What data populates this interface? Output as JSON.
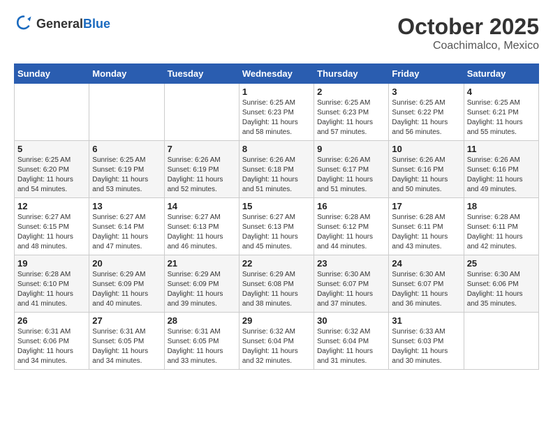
{
  "header": {
    "logo_line1": "General",
    "logo_line2": "Blue",
    "title": "October 2025",
    "subtitle": "Coachimalco, Mexico"
  },
  "days_of_week": [
    "Sunday",
    "Monday",
    "Tuesday",
    "Wednesday",
    "Thursday",
    "Friday",
    "Saturday"
  ],
  "weeks": [
    [
      {
        "day": "",
        "info": ""
      },
      {
        "day": "",
        "info": ""
      },
      {
        "day": "",
        "info": ""
      },
      {
        "day": "1",
        "info": "Sunrise: 6:25 AM\nSunset: 6:23 PM\nDaylight: 11 hours\nand 58 minutes."
      },
      {
        "day": "2",
        "info": "Sunrise: 6:25 AM\nSunset: 6:23 PM\nDaylight: 11 hours\nand 57 minutes."
      },
      {
        "day": "3",
        "info": "Sunrise: 6:25 AM\nSunset: 6:22 PM\nDaylight: 11 hours\nand 56 minutes."
      },
      {
        "day": "4",
        "info": "Sunrise: 6:25 AM\nSunset: 6:21 PM\nDaylight: 11 hours\nand 55 minutes."
      }
    ],
    [
      {
        "day": "5",
        "info": "Sunrise: 6:25 AM\nSunset: 6:20 PM\nDaylight: 11 hours\nand 54 minutes."
      },
      {
        "day": "6",
        "info": "Sunrise: 6:25 AM\nSunset: 6:19 PM\nDaylight: 11 hours\nand 53 minutes."
      },
      {
        "day": "7",
        "info": "Sunrise: 6:26 AM\nSunset: 6:19 PM\nDaylight: 11 hours\nand 52 minutes."
      },
      {
        "day": "8",
        "info": "Sunrise: 6:26 AM\nSunset: 6:18 PM\nDaylight: 11 hours\nand 51 minutes."
      },
      {
        "day": "9",
        "info": "Sunrise: 6:26 AM\nSunset: 6:17 PM\nDaylight: 11 hours\nand 51 minutes."
      },
      {
        "day": "10",
        "info": "Sunrise: 6:26 AM\nSunset: 6:16 PM\nDaylight: 11 hours\nand 50 minutes."
      },
      {
        "day": "11",
        "info": "Sunrise: 6:26 AM\nSunset: 6:16 PM\nDaylight: 11 hours\nand 49 minutes."
      }
    ],
    [
      {
        "day": "12",
        "info": "Sunrise: 6:27 AM\nSunset: 6:15 PM\nDaylight: 11 hours\nand 48 minutes."
      },
      {
        "day": "13",
        "info": "Sunrise: 6:27 AM\nSunset: 6:14 PM\nDaylight: 11 hours\nand 47 minutes."
      },
      {
        "day": "14",
        "info": "Sunrise: 6:27 AM\nSunset: 6:13 PM\nDaylight: 11 hours\nand 46 minutes."
      },
      {
        "day": "15",
        "info": "Sunrise: 6:27 AM\nSunset: 6:13 PM\nDaylight: 11 hours\nand 45 minutes."
      },
      {
        "day": "16",
        "info": "Sunrise: 6:28 AM\nSunset: 6:12 PM\nDaylight: 11 hours\nand 44 minutes."
      },
      {
        "day": "17",
        "info": "Sunrise: 6:28 AM\nSunset: 6:11 PM\nDaylight: 11 hours\nand 43 minutes."
      },
      {
        "day": "18",
        "info": "Sunrise: 6:28 AM\nSunset: 6:11 PM\nDaylight: 11 hours\nand 42 minutes."
      }
    ],
    [
      {
        "day": "19",
        "info": "Sunrise: 6:28 AM\nSunset: 6:10 PM\nDaylight: 11 hours\nand 41 minutes."
      },
      {
        "day": "20",
        "info": "Sunrise: 6:29 AM\nSunset: 6:09 PM\nDaylight: 11 hours\nand 40 minutes."
      },
      {
        "day": "21",
        "info": "Sunrise: 6:29 AM\nSunset: 6:09 PM\nDaylight: 11 hours\nand 39 minutes."
      },
      {
        "day": "22",
        "info": "Sunrise: 6:29 AM\nSunset: 6:08 PM\nDaylight: 11 hours\nand 38 minutes."
      },
      {
        "day": "23",
        "info": "Sunrise: 6:30 AM\nSunset: 6:07 PM\nDaylight: 11 hours\nand 37 minutes."
      },
      {
        "day": "24",
        "info": "Sunrise: 6:30 AM\nSunset: 6:07 PM\nDaylight: 11 hours\nand 36 minutes."
      },
      {
        "day": "25",
        "info": "Sunrise: 6:30 AM\nSunset: 6:06 PM\nDaylight: 11 hours\nand 35 minutes."
      }
    ],
    [
      {
        "day": "26",
        "info": "Sunrise: 6:31 AM\nSunset: 6:06 PM\nDaylight: 11 hours\nand 34 minutes."
      },
      {
        "day": "27",
        "info": "Sunrise: 6:31 AM\nSunset: 6:05 PM\nDaylight: 11 hours\nand 34 minutes."
      },
      {
        "day": "28",
        "info": "Sunrise: 6:31 AM\nSunset: 6:05 PM\nDaylight: 11 hours\nand 33 minutes."
      },
      {
        "day": "29",
        "info": "Sunrise: 6:32 AM\nSunset: 6:04 PM\nDaylight: 11 hours\nand 32 minutes."
      },
      {
        "day": "30",
        "info": "Sunrise: 6:32 AM\nSunset: 6:04 PM\nDaylight: 11 hours\nand 31 minutes."
      },
      {
        "day": "31",
        "info": "Sunrise: 6:33 AM\nSunset: 6:03 PM\nDaylight: 11 hours\nand 30 minutes."
      },
      {
        "day": "",
        "info": ""
      }
    ]
  ]
}
